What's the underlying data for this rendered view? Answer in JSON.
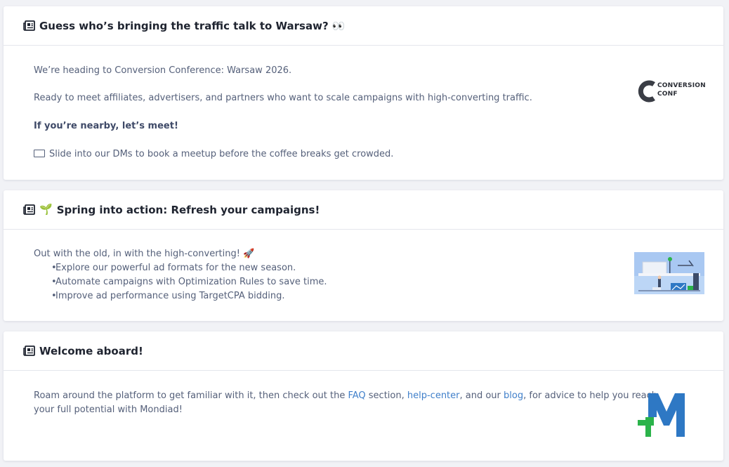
{
  "cards": [
    {
      "title": "Guess who’s bringing the traffic talk to Warsaw? 👀",
      "p1": "We’re heading to Conversion Conference: Warsaw 2026.",
      "p2": "Ready to meet affiliates, advertisers, and partners who want to scale campaigns with high-converting traffic.",
      "p3": "If you’re nearby, let’s meet!",
      "p4": "Slide into our DMs to book a meetup before the coffee breaks get crowded.",
      "logo_line1": "CONVERSION",
      "logo_line2": "CONF"
    },
    {
      "title": "Spring into action: Refresh your campaigns!",
      "sprout_icon": "🌱",
      "intro": "Out with the old, in with the high-converting!",
      "rocket_icon": "🚀",
      "bullets": [
        "Explore our powerful ad formats for the new season.",
        "Automate campaigns with Optimization Rules to save time.",
        "Improve ad performance using TargetCPA bidding."
      ]
    },
    {
      "title": "Welcome aboard!",
      "text_a": "Roam around the platform to get familiar with it, then check out the ",
      "link_faq": "FAQ",
      "text_b": " section, ",
      "link_help": "help-center",
      "text_c": ", and our ",
      "link_blog": "blog",
      "text_d": ", for advice to help you reach",
      "text_e": "your full potential with Mondiad!"
    }
  ],
  "colors": {
    "link": "#3f7fca",
    "logo_blue": "#2e78c4",
    "logo_green": "#2bb34a"
  }
}
